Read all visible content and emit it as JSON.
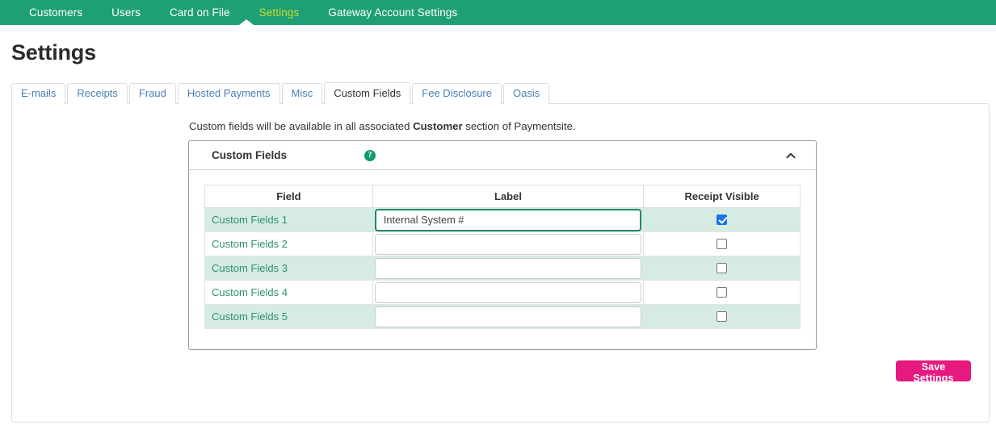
{
  "topnav": {
    "items": [
      {
        "label": "Customers",
        "active": false
      },
      {
        "label": "Users",
        "active": false
      },
      {
        "label": "Card on File",
        "active": false
      },
      {
        "label": "Settings",
        "active": true
      },
      {
        "label": "Gateway Account Settings",
        "active": false
      }
    ],
    "background_color": "#1fa074",
    "active_color": "#c8dc32"
  },
  "page": {
    "title": "Settings"
  },
  "tabs": [
    {
      "label": "E-mails",
      "active": false
    },
    {
      "label": "Receipts",
      "active": false
    },
    {
      "label": "Fraud",
      "active": false
    },
    {
      "label": "Hosted Payments",
      "active": false
    },
    {
      "label": "Misc",
      "active": false
    },
    {
      "label": "Custom Fields",
      "active": true
    },
    {
      "label": "Fee Disclosure",
      "active": false
    },
    {
      "label": "Oasis",
      "active": false
    }
  ],
  "main": {
    "intro_prefix": "Custom fields will be available in all associated ",
    "intro_bold": "Customer",
    "intro_suffix": " section of Paymentsite.",
    "card": {
      "title": "Custom Fields",
      "help_icon": "help-circle-icon",
      "help_glyph": "?",
      "collapse_icon": "chevron-up-icon"
    },
    "table": {
      "headers": [
        "Field",
        "Label",
        "Receipt Visible"
      ],
      "rows": [
        {
          "field": "Custom Fields 1",
          "label_value": "Internal System #",
          "label_placeholder": "",
          "receipt_visible": true,
          "focused": true,
          "shaded": true
        },
        {
          "field": "Custom Fields 2",
          "label_value": "",
          "label_placeholder": "",
          "receipt_visible": false,
          "focused": false,
          "shaded": false
        },
        {
          "field": "Custom Fields 3",
          "label_value": "",
          "label_placeholder": "",
          "receipt_visible": false,
          "focused": false,
          "shaded": true
        },
        {
          "field": "Custom Fields 4",
          "label_value": "",
          "label_placeholder": "",
          "receipt_visible": false,
          "focused": false,
          "shaded": false
        },
        {
          "field": "Custom Fields 5",
          "label_value": "",
          "label_placeholder": "",
          "receipt_visible": false,
          "focused": false,
          "shaded": true
        }
      ]
    },
    "save_label": "Save Settings",
    "save_color": "#e6197f"
  }
}
